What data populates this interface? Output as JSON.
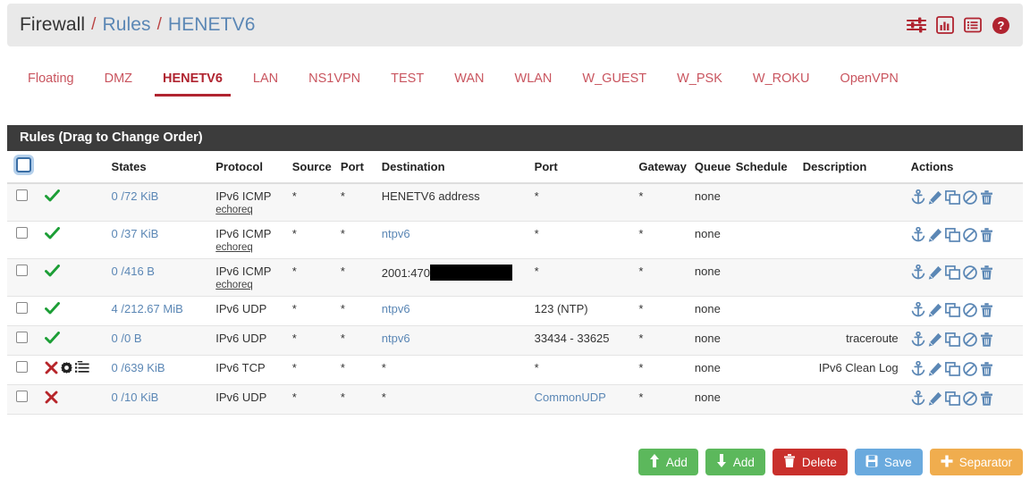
{
  "breadcrumb": {
    "root": "Firewall",
    "sep": "/",
    "section": "Rules",
    "current": "HENETV6",
    "icons": [
      "sliders-icon",
      "chart-icon",
      "list-icon",
      "help-icon"
    ]
  },
  "tabs": [
    {
      "label": "Floating",
      "active": false
    },
    {
      "label": "DMZ",
      "active": false
    },
    {
      "label": "HENETV6",
      "active": true
    },
    {
      "label": "LAN",
      "active": false
    },
    {
      "label": "NS1VPN",
      "active": false
    },
    {
      "label": "TEST",
      "active": false
    },
    {
      "label": "WAN",
      "active": false
    },
    {
      "label": "WLAN",
      "active": false
    },
    {
      "label": "W_GUEST",
      "active": false
    },
    {
      "label": "W_PSK",
      "active": false
    },
    {
      "label": "W_ROKU",
      "active": false
    },
    {
      "label": "OpenVPN",
      "active": false
    }
  ],
  "panel": {
    "title": "Rules (Drag to Change Order)",
    "columns": [
      "",
      "",
      "States",
      "Protocol",
      "Source",
      "Port",
      "Destination",
      "Port",
      "Gateway",
      "Queue",
      "Schedule",
      "Description",
      "Actions"
    ],
    "rows": [
      {
        "status": [
          "pass"
        ],
        "states": "0 /72 KiB",
        "protocol": "IPv6 ICMP",
        "protocol_sub": "echoreq",
        "source": "*",
        "source_port": "*",
        "destination": "HENETV6 address",
        "destination_link": false,
        "redacted": false,
        "dest_port": "*",
        "dest_port_link": false,
        "gateway": "*",
        "queue": "none",
        "schedule": "",
        "description": ""
      },
      {
        "status": [
          "pass"
        ],
        "states": "0 /37 KiB",
        "protocol": "IPv6 ICMP",
        "protocol_sub": "echoreq",
        "source": "*",
        "source_port": "*",
        "destination": "ntpv6",
        "destination_link": true,
        "redacted": false,
        "dest_port": "*",
        "dest_port_link": false,
        "gateway": "*",
        "queue": "none",
        "schedule": "",
        "description": ""
      },
      {
        "status": [
          "pass"
        ],
        "states": "0 /416 B",
        "protocol": "IPv6 ICMP",
        "protocol_sub": "echoreq",
        "source": "*",
        "source_port": "*",
        "destination": "2001:470",
        "destination_link": false,
        "redacted": true,
        "dest_port": "*",
        "dest_port_link": false,
        "gateway": "*",
        "queue": "none",
        "schedule": "",
        "description": ""
      },
      {
        "status": [
          "pass"
        ],
        "states": "4 /212.67 MiB",
        "protocol": "IPv6 UDP",
        "protocol_sub": "",
        "source": "*",
        "source_port": "*",
        "destination": "ntpv6",
        "destination_link": true,
        "redacted": false,
        "dest_port": "123 (NTP)",
        "dest_port_link": false,
        "gateway": "*",
        "queue": "none",
        "schedule": "",
        "description": ""
      },
      {
        "status": [
          "pass"
        ],
        "states": "0 /0 B",
        "protocol": "IPv6 UDP",
        "protocol_sub": "",
        "source": "*",
        "source_port": "*",
        "destination": "ntpv6",
        "destination_link": true,
        "redacted": false,
        "dest_port": "33434 - 33625",
        "dest_port_link": false,
        "gateway": "*",
        "queue": "none",
        "schedule": "",
        "description": "traceroute"
      },
      {
        "status": [
          "block",
          "advanced",
          "log"
        ],
        "states": "0 /639 KiB",
        "protocol": "IPv6 TCP",
        "protocol_sub": "",
        "source": "*",
        "source_port": "*",
        "destination": "*",
        "destination_link": false,
        "redacted": false,
        "dest_port": "*",
        "dest_port_link": false,
        "gateway": "*",
        "queue": "none",
        "schedule": "",
        "description": "IPv6 Clean Log"
      },
      {
        "status": [
          "block"
        ],
        "states": "0 /10 KiB",
        "protocol": "IPv6 UDP",
        "protocol_sub": "",
        "source": "*",
        "source_port": "*",
        "destination": "*",
        "destination_link": false,
        "redacted": false,
        "dest_port": "CommonUDP",
        "dest_port_link": true,
        "gateway": "*",
        "queue": "none",
        "schedule": "",
        "description": ""
      }
    ],
    "row_action_icons": [
      "anchor-icon",
      "edit-icon",
      "copy-icon",
      "disable-icon",
      "delete-icon"
    ]
  },
  "footer_buttons": [
    {
      "label": "Add",
      "icon": "arrow-up-icon",
      "style": "green"
    },
    {
      "label": "Add",
      "icon": "arrow-down-icon",
      "style": "green"
    },
    {
      "label": "Delete",
      "icon": "trash-icon",
      "style": "red"
    },
    {
      "label": "Save",
      "icon": "save-icon",
      "style": "blue"
    },
    {
      "label": "Separator",
      "icon": "plus-icon",
      "style": "orange"
    }
  ],
  "colors": {
    "accent_red": "#b02430",
    "link_blue": "#5b87b5",
    "pass_green": "#1c9e36",
    "block_red": "#b7252a",
    "panel_dark": "#3c3c3c"
  }
}
